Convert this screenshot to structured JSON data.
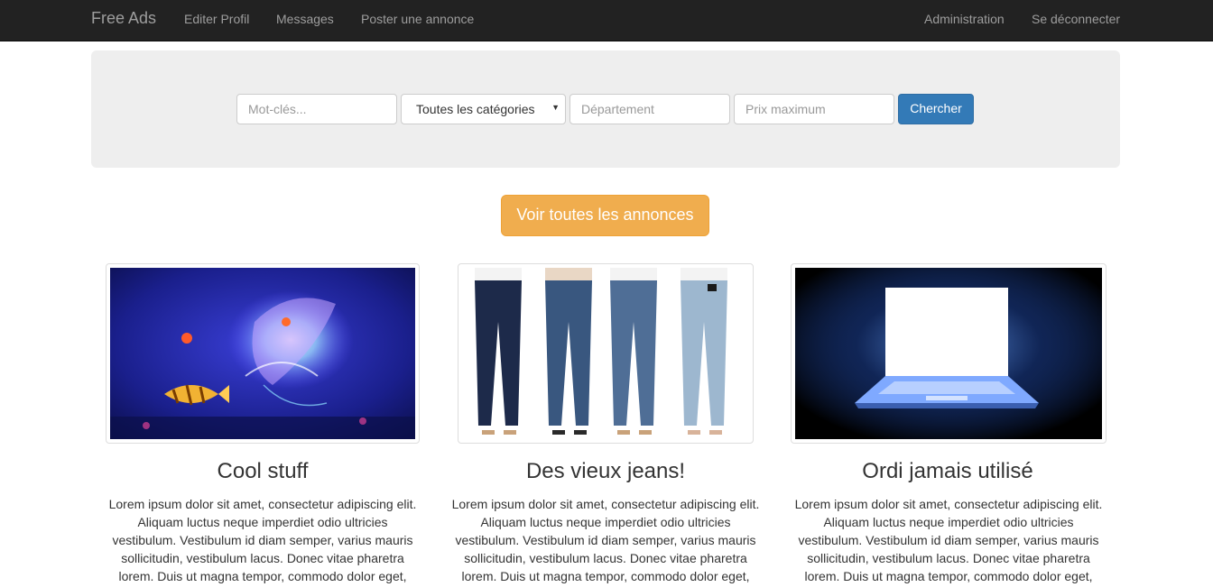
{
  "navbar": {
    "brand": "Free Ads",
    "left_links": [
      "Editer Profil",
      "Messages",
      "Poster une annonce"
    ],
    "right_links": [
      "Administration",
      "Se déconnecter"
    ],
    "background": "#222222",
    "link_color": "#9d9d9d"
  },
  "search": {
    "keywords_placeholder": "Mot-clés...",
    "category_value": "Toutes les catégories",
    "department_placeholder": "Département",
    "max_price_placeholder": "Prix maximum",
    "submit_label": "Chercher",
    "submit_color": "#337ab7"
  },
  "see_all": {
    "label": "Voir toutes les annonces",
    "color": "#f0ad4e"
  },
  "cards": [
    {
      "title": "Cool stuff",
      "image": "jellyfish-and-fish-photo",
      "text": "Lorem ipsum dolor sit amet, consectetur adipiscing elit. Aliquam luctus neque imperdiet odio ultricies vestibulum. Vestibulum id diam semper, varius mauris sollicitudin, vestibulum lacus. Donec vitae pharetra lorem. Duis ut magna tempor, commodo dolor eget,"
    },
    {
      "title": "Des vieux jeans!",
      "image": "four-pairs-of-jeans-photo",
      "text": "Lorem ipsum dolor sit amet, consectetur adipiscing elit. Aliquam luctus neque imperdiet odio ultricies vestibulum. Vestibulum id diam semper, varius mauris sollicitudin, vestibulum lacus. Donec vitae pharetra lorem. Duis ut magna tempor, commodo dolor eget,"
    },
    {
      "title": "Ordi jamais utilisé",
      "image": "glowing-laptop-photo",
      "text": "Lorem ipsum dolor sit amet, consectetur adipiscing elit. Aliquam luctus neque imperdiet odio ultricies vestibulum. Vestibulum id diam semper, varius mauris sollicitudin, vestibulum lacus. Donec vitae pharetra lorem. Duis ut magna tempor, commodo dolor eget,"
    }
  ]
}
